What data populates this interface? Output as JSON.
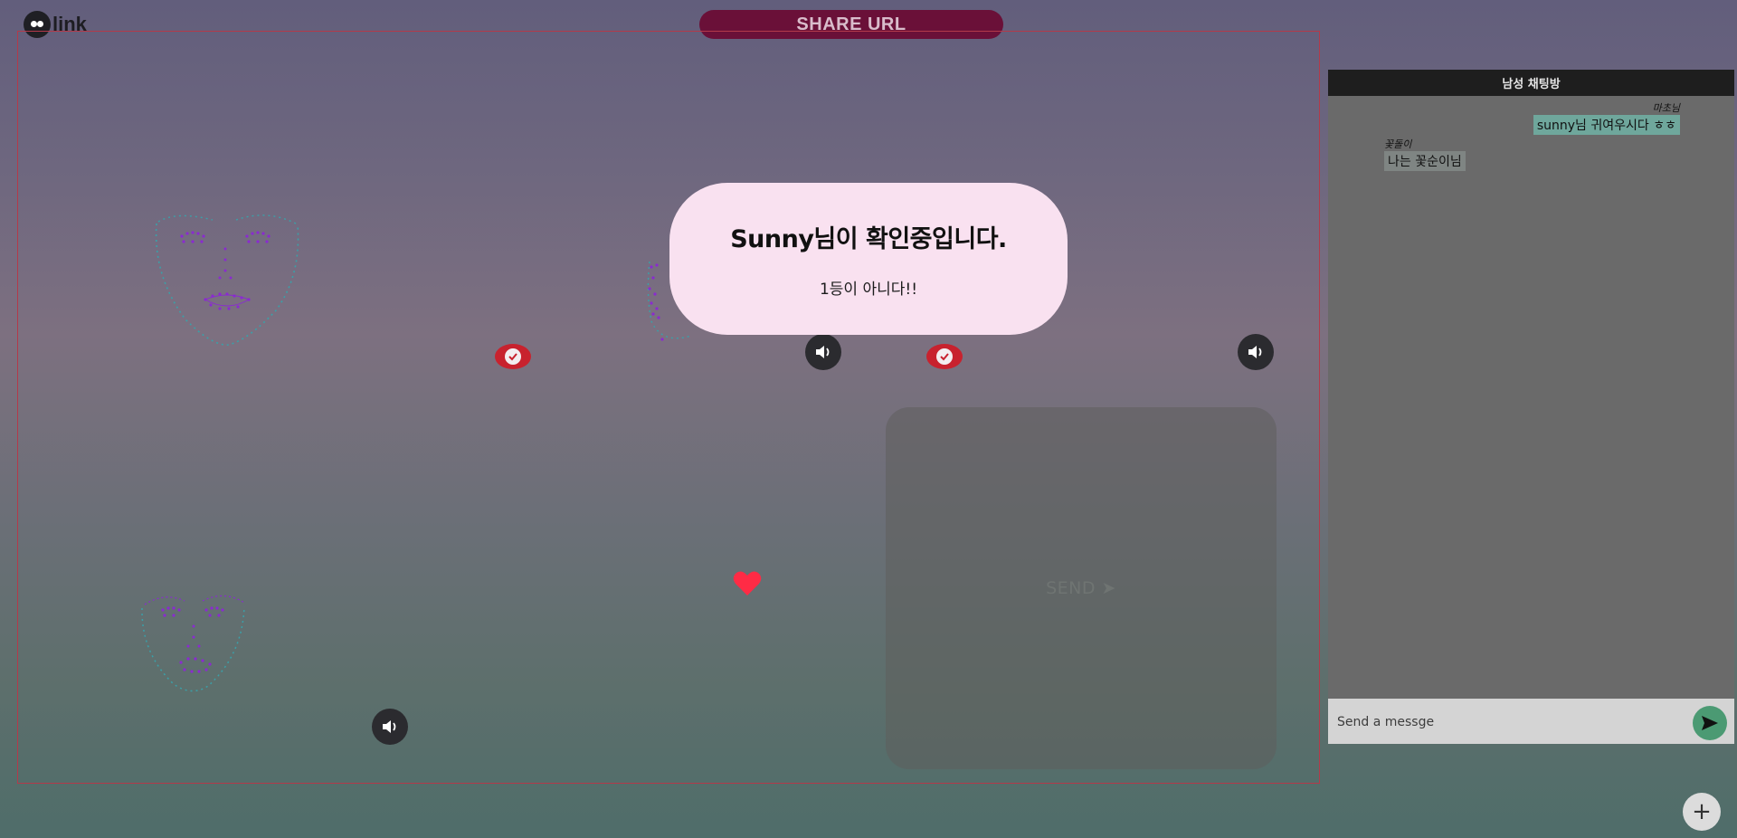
{
  "logo": {
    "text": "link",
    "sub": ""
  },
  "header": {
    "share_label": "SHARE URL"
  },
  "modal": {
    "title": "Sunny님이 확인중입니다.",
    "subtitle": "1등이 아니다!!"
  },
  "send_card": {
    "label": "SEND ➤"
  },
  "chat": {
    "title": "남성 채팅방",
    "messages": [
      {
        "sender": "마초님",
        "text": "sunny님 귀여우시다 ㅎㅎ",
        "align": "right"
      },
      {
        "sender": "꽃돌이",
        "text": "나는 꽃순이님",
        "align": "left"
      }
    ],
    "input_placeholder": "Send a messge"
  },
  "colors": {
    "share_bg": "#6a1038",
    "modal_bg": "#f9e1f0",
    "check_red": "#c8222e",
    "send_green": "#4b9a73",
    "heart": "#ff2b45",
    "face_line": "#3aa0a8",
    "face_dot": "#8a2bd0"
  },
  "icons": {
    "speaker": "speaker-icon",
    "check": "check-icon",
    "heart": "heart-icon",
    "send": "send-icon",
    "plus": "plus-icon"
  }
}
